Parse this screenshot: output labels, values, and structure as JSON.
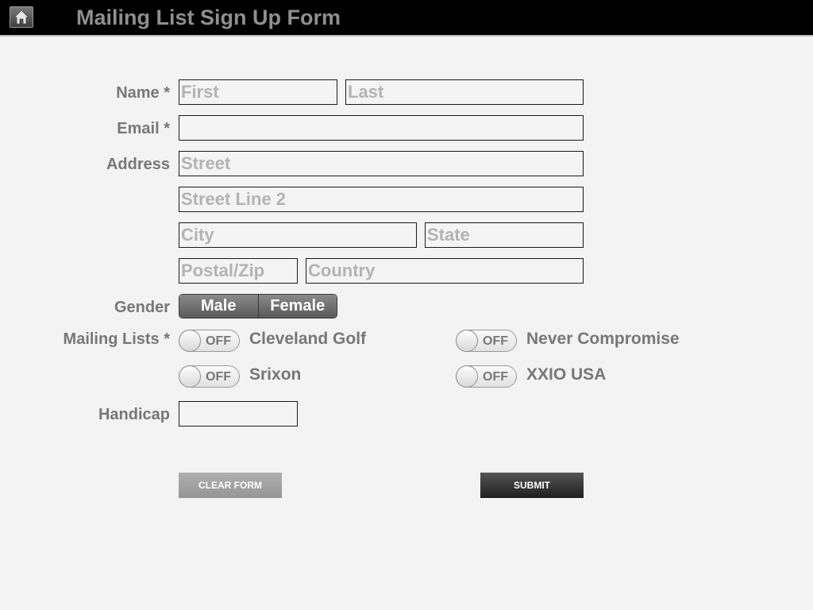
{
  "header": {
    "title": "Mailing List Sign Up Form",
    "home_icon": "home-icon"
  },
  "form": {
    "name": {
      "label": "Name *",
      "first_placeholder": "First",
      "last_placeholder": "Last",
      "first_value": "",
      "last_value": ""
    },
    "email": {
      "label": "Email *",
      "placeholder": "",
      "value": ""
    },
    "address": {
      "label": "Address",
      "street_placeholder": "Street",
      "street2_placeholder": "Street Line 2",
      "city_placeholder": "City",
      "state_placeholder": "State",
      "postal_placeholder": "Postal/Zip",
      "country_placeholder": "Country"
    },
    "gender": {
      "label": "Gender",
      "options": [
        "Male",
        "Female"
      ]
    },
    "mailing_lists": {
      "label": "Mailing Lists *",
      "items": [
        {
          "name": "Cleveland Golf",
          "state": "OFF"
        },
        {
          "name": "Never Compromise",
          "state": "OFF"
        },
        {
          "name": "Srixon",
          "state": "OFF"
        },
        {
          "name": "XXIO USA",
          "state": "OFF"
        }
      ]
    },
    "handicap": {
      "label": "Handicap",
      "value": ""
    },
    "buttons": {
      "clear": "CLEAR FORM",
      "submit": "SUBMIT"
    }
  },
  "colors": {
    "background": "#f3f3f3",
    "topbar": "#000000",
    "label_text": "#777777",
    "placeholder": "#b3b3b3",
    "submit_button": "#2b2b2b",
    "clear_button": "#a3a3a3"
  }
}
